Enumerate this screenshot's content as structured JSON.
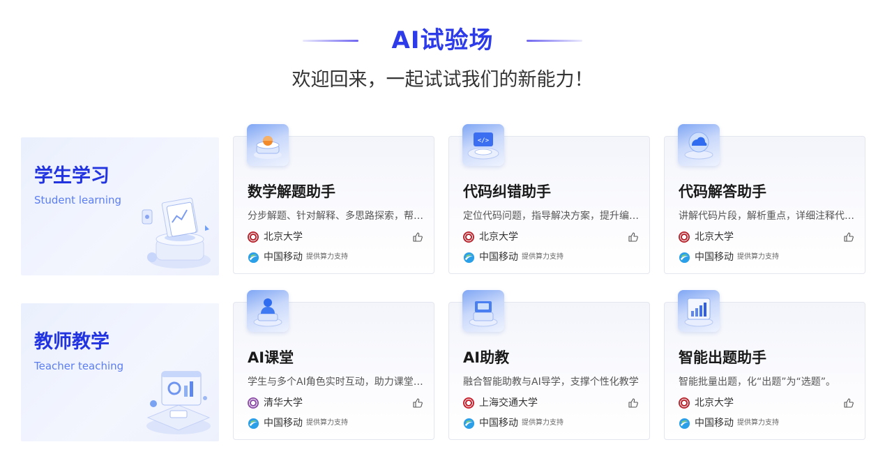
{
  "header": {
    "title": "AI试验场",
    "subtitle": "欢迎回来，一起试试我们的新能力！"
  },
  "sections": [
    {
      "title": "学生学习",
      "subtitle": "Student learning",
      "cards": [
        {
          "name": "数学解题助手",
          "desc": "分步解题、针对解释、多思路探索，帮助学生掌握解题方法",
          "org": "北京大学",
          "org_logo": "pku-logo-icon",
          "power_by": "中国移动",
          "power_text": "提供算力支持"
        },
        {
          "name": "代码纠错助手",
          "desc": "定位代码问题，指导解决方案，提升编程能力",
          "org": "北京大学",
          "org_logo": "pku-logo-icon",
          "power_by": "中国移动",
          "power_text": "提供算力支持"
        },
        {
          "name": "代码解答助手",
          "desc": "讲解代码片段，解析重点，详细注释代码逻辑",
          "org": "北京大学",
          "org_logo": "pku-logo-icon",
          "power_by": "中国移动",
          "power_text": "提供算力支持"
        }
      ]
    },
    {
      "title": "教师教学",
      "subtitle": "Teacher teaching",
      "cards": [
        {
          "name": "AI课堂",
          "desc": "学生与多个AI角色实时互动，助力课堂教学",
          "org": "清华大学",
          "org_logo": "thu-logo-icon",
          "power_by": "中国移动",
          "power_text": "提供算力支持"
        },
        {
          "name": "AI助教",
          "desc": "融合智能助教与AI导学，支撑个性化教学",
          "org": "上海交通大学",
          "org_logo": "sjtu-logo-icon",
          "power_by": "中国移动",
          "power_text": "提供算力支持"
        },
        {
          "name": "智能出题助手",
          "desc": "智能批量出题，化“出题”为“选题”。",
          "org": "北京大学",
          "org_logo": "pku-logo-icon",
          "power_by": "中国移动",
          "power_text": "提供算力支持"
        }
      ]
    }
  ],
  "colors": {
    "accent": "#2d3be8",
    "category_title": "#2233e0",
    "category_subtitle": "#5b7df2"
  }
}
